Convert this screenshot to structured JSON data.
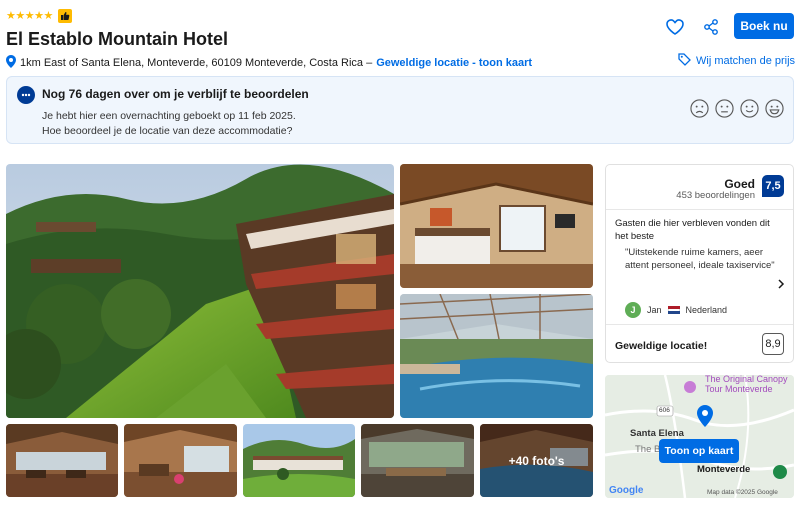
{
  "header": {
    "stars": "★★★★★",
    "hotel_name": "El Establo Mountain Hotel",
    "address": "1km East of Santa Elena, Monteverde, 60109 Monteverde, Costa Rica –",
    "location_link": "Geweldige locatie - toon kaart",
    "book_label": "Boek nu",
    "match_label": "Wij matchen de prijs"
  },
  "review_prompt": {
    "title": "Nog 76 dagen over om je verblijf te beoordelen",
    "line1": "Je hebt hier een overnachting geboekt op 11 feb 2025.",
    "line2": "Hoe beoordeel je de locatie van deze accommodatie?"
  },
  "score": {
    "word": "Goed",
    "count": "453 beoordelingen",
    "value": "7,5",
    "guest_intro": "Gasten die hier verbleven vonden dit het beste",
    "quote": "\"Uitstekende ruime kamers, aeer attent personeel, ideale taxiservice\"",
    "reviewer_initial": "J",
    "reviewer_name": "Jan",
    "reviewer_country": "Nederland",
    "location_label": "Geweldige locatie!",
    "location_score": "8,9"
  },
  "map": {
    "button_label": "Toon op kaart",
    "label_canopy": "The Original Canopy",
    "label_canopy2": "Tour Monteverde",
    "label_santa_elena": "Santa Elena",
    "label_monteverde": "Monteverde",
    "label_road": "606",
    "label_partial": "The B",
    "footer": "Map data ©2025 Google",
    "logo": "Google"
  },
  "gallery": {
    "more_photos": "+40 foto's"
  },
  "colors": {
    "brand_blue": "#006ce4",
    "dark_blue": "#003b95",
    "star_yellow": "#febb02"
  }
}
